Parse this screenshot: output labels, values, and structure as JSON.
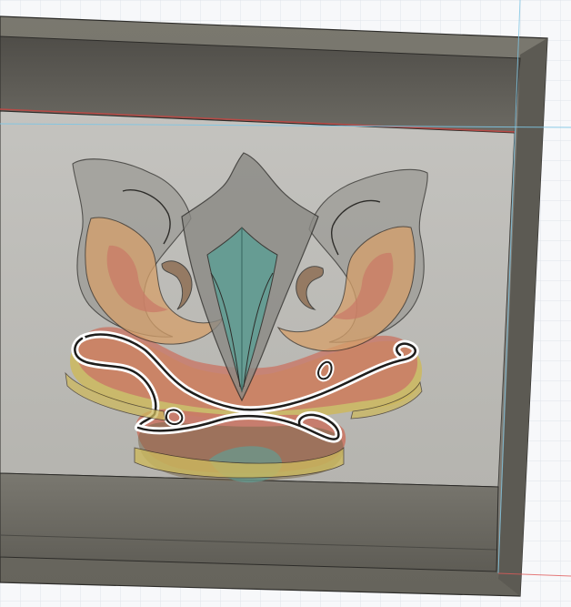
{
  "viewport": {
    "view": "3d-perspective",
    "background_color": "#f7f8fa",
    "grid_color": "#dfe3ea",
    "axis_x_color": "#e05a5a",
    "axis_y_color": "#7fc6e4",
    "box_frame_color": "#6e6c64",
    "box_inner_color": "#595751",
    "box_floor_color": "#c8c7c3",
    "box_bottom_color": "#727069"
  },
  "model": {
    "shapes": [
      "outer-petals",
      "center-leaf",
      "crossed-swirl"
    ],
    "layer_colors": {
      "teal": "#5f9e95",
      "orange": "#d6a06a",
      "red": "#c97766",
      "yellow": "#cdb95e",
      "grey": "#9c9b96",
      "outline_highlight": "#ffffff"
    },
    "selected": "crossed-swirl"
  }
}
